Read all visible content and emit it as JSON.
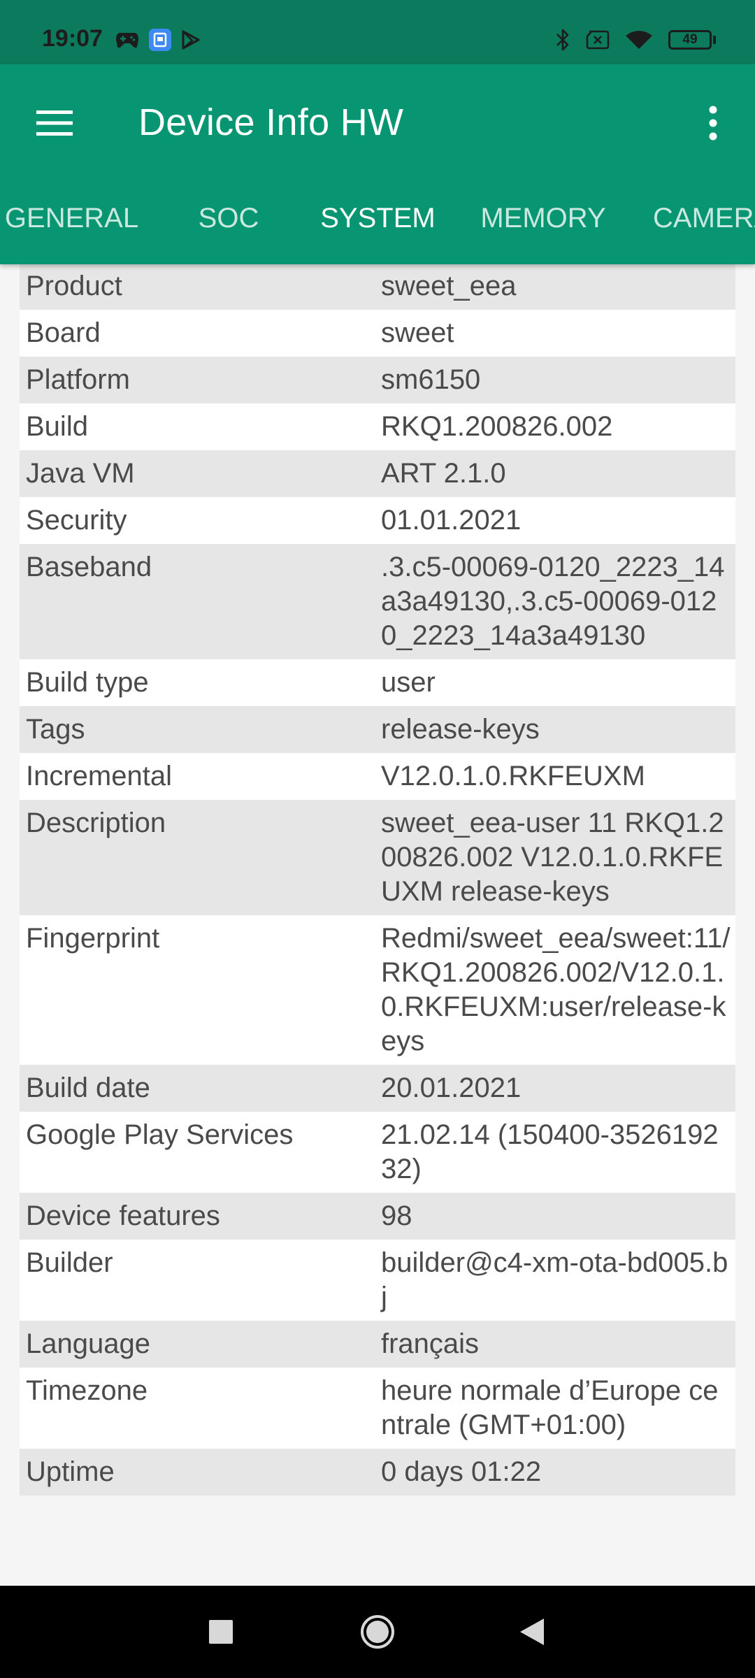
{
  "status_bar": {
    "time": "19:07",
    "battery_level": "49",
    "left_icons": [
      "gamepad-icon",
      "app-notification-icon",
      "play-store-icon"
    ],
    "right_icons": [
      "bluetooth-icon",
      "no-sim-icon",
      "wifi-icon",
      "battery-icon"
    ]
  },
  "app_bar": {
    "title": "Device Info HW",
    "menu_icon": "hamburger-menu-icon",
    "overflow_icon": "more-vertical-icon"
  },
  "tabs": [
    {
      "label": "GENERAL",
      "active": false
    },
    {
      "label": "SOC",
      "active": false
    },
    {
      "label": "SYSTEM",
      "active": true
    },
    {
      "label": "MEMORY",
      "active": false
    },
    {
      "label": "CAMERA",
      "active": false
    }
  ],
  "rows": [
    {
      "key": "Product",
      "value": "sweet_eea"
    },
    {
      "key": "Board",
      "value": "sweet"
    },
    {
      "key": "Platform",
      "value": "sm6150"
    },
    {
      "key": "Build",
      "value": "RKQ1.200826.002"
    },
    {
      "key": "Java VM",
      "value": "ART 2.1.0"
    },
    {
      "key": "Security",
      "value": "01.01.2021"
    },
    {
      "key": "Baseband",
      "value": ".3.c5-00069-0120_2223_14a3a49130,.3.c5-00069-0120_2223_14a3a49130"
    },
    {
      "key": "Build type",
      "value": "user"
    },
    {
      "key": "Tags",
      "value": "release-keys"
    },
    {
      "key": "Incremental",
      "value": "V12.0.1.0.RKFEUXM"
    },
    {
      "key": "Description",
      "value": "sweet_eea-user 11 RKQ1.200826.002 V12.0.1.0.RKFEUXM release-keys"
    },
    {
      "key": "Fingerprint",
      "value": "Redmi/sweet_eea/sweet:11/RKQ1.200826.002/V12.0.1.0.RKFEUXM:user/release-keys"
    },
    {
      "key": "Build date",
      "value": "20.01.2021"
    },
    {
      "key": "Google Play Services",
      "value": "21.02.14 (150400-352619232)"
    },
    {
      "key": "Device features",
      "value": "98"
    },
    {
      "key": "Builder",
      "value": "builder@c4-xm-ota-bd005.bj"
    },
    {
      "key": "Language",
      "value": "français"
    },
    {
      "key": "Timezone",
      "value": "heure normale d’Europe centrale (GMT+01:00)"
    },
    {
      "key": "Uptime",
      "value": "0 days 01:22"
    }
  ],
  "nav_bar": {
    "icons": [
      "recents-square-icon",
      "home-circle-icon",
      "back-triangle-icon"
    ]
  },
  "colors": {
    "status_bar": "#0c7a5c",
    "app_bar": "#079671",
    "row_shaded": "#e6e6e6",
    "row_plain": "#ffffff",
    "text": "#4a4a4a"
  }
}
